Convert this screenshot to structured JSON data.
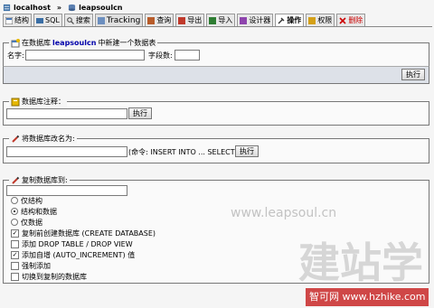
{
  "breadcrumb": {
    "server": "localhost",
    "separator": "»",
    "database": "leapsoulcn"
  },
  "tabs": [
    {
      "label": "结构"
    },
    {
      "label": "SQL"
    },
    {
      "label": "搜索"
    },
    {
      "label": "Tracking"
    },
    {
      "label": "查询"
    },
    {
      "label": "导出"
    },
    {
      "label": "导入"
    },
    {
      "label": "设计器"
    },
    {
      "label": "操作"
    },
    {
      "label": "权限"
    },
    {
      "label": "删除"
    }
  ],
  "create_table": {
    "legend_prefix": "在数据库",
    "legend_db": "leapsoulcn",
    "legend_suffix": "中新建一个数据表",
    "name_label": "名字:",
    "fields_label": "字段数:",
    "execute_label": "执行"
  },
  "db_comment": {
    "legend": "数据库注释：",
    "execute_label": "执行"
  },
  "rename_db": {
    "legend": "将数据库改名为:",
    "hint": "(命令: INSERT INTO ... SELECT)",
    "execute_label": "执行"
  },
  "copy_db": {
    "legend": "复制数据库到:",
    "radios": [
      {
        "label": "仅结构",
        "checked": false
      },
      {
        "label": "结构和数据",
        "checked": true
      },
      {
        "label": "仅数据",
        "checked": false
      }
    ],
    "checkboxes": [
      {
        "label": "复制前创建数据库 (CREATE DATABASE)",
        "checked": true
      },
      {
        "label": "添加 DROP TABLE / DROP VIEW",
        "checked": false
      },
      {
        "label": "添加自增 (AUTO_INCREMENT) 值",
        "checked": true
      },
      {
        "label": "强制添加",
        "checked": false
      },
      {
        "label": "切换到复制的数据库",
        "checked": false
      }
    ]
  },
  "watermarks": {
    "site": "www.leapsoul.cn",
    "brand_big": "建站学",
    "brand_small": "智可网 www.hzhike.com"
  }
}
